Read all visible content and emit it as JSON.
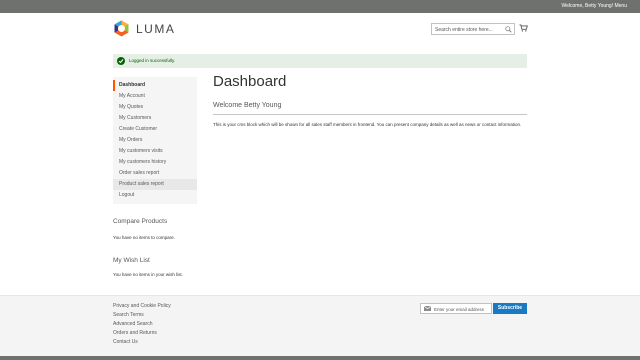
{
  "topbar": {
    "welcome": "Welcome, Betty Young! Menu"
  },
  "header": {
    "brand": "LUMA",
    "search_placeholder": "Search entire store here..."
  },
  "alert": {
    "message": "Logged in successfully."
  },
  "sidebar": {
    "items": [
      {
        "label": "Dashboard",
        "active": true
      },
      {
        "label": "My Account"
      },
      {
        "label": "My Quotes"
      },
      {
        "label": "My Customers"
      },
      {
        "label": "Create Customer"
      },
      {
        "label": "My Orders"
      },
      {
        "label": "My customers visits"
      },
      {
        "label": "My customers history"
      },
      {
        "label": "Order sales report"
      },
      {
        "label": "Product sales report",
        "hover": true
      },
      {
        "label": "Logout"
      }
    ]
  },
  "compare": {
    "title": "Compare Products",
    "empty": "You have no items to compare."
  },
  "wishlist": {
    "title": "My Wish List",
    "empty": "You have no items in your wish list."
  },
  "main": {
    "title": "Dashboard",
    "section_title": "Welcome Betty Young",
    "cms_text": "This is your cms block which will be shown for all sales staff members in frontend. You can present company details as well as news or contact information."
  },
  "footer": {
    "links": [
      "Privacy and Cookie Policy",
      "Search Terms",
      "Advanced Search",
      "Orders and Returns",
      "Contact Us"
    ],
    "newsletter_placeholder": "Enter your email address",
    "subscribe_label": "Subscribe"
  },
  "colors": {
    "topbar": "#6e716e",
    "alert_bg": "#e5efe5",
    "alert_text": "#006400",
    "active_accent": "#ff5501",
    "button": "#1979c3"
  },
  "icons": {
    "logo": "luma-logo-icon",
    "search": "search-icon",
    "cart": "cart-icon",
    "success": "check-circle-icon",
    "newsletter": "envelope-icon"
  }
}
